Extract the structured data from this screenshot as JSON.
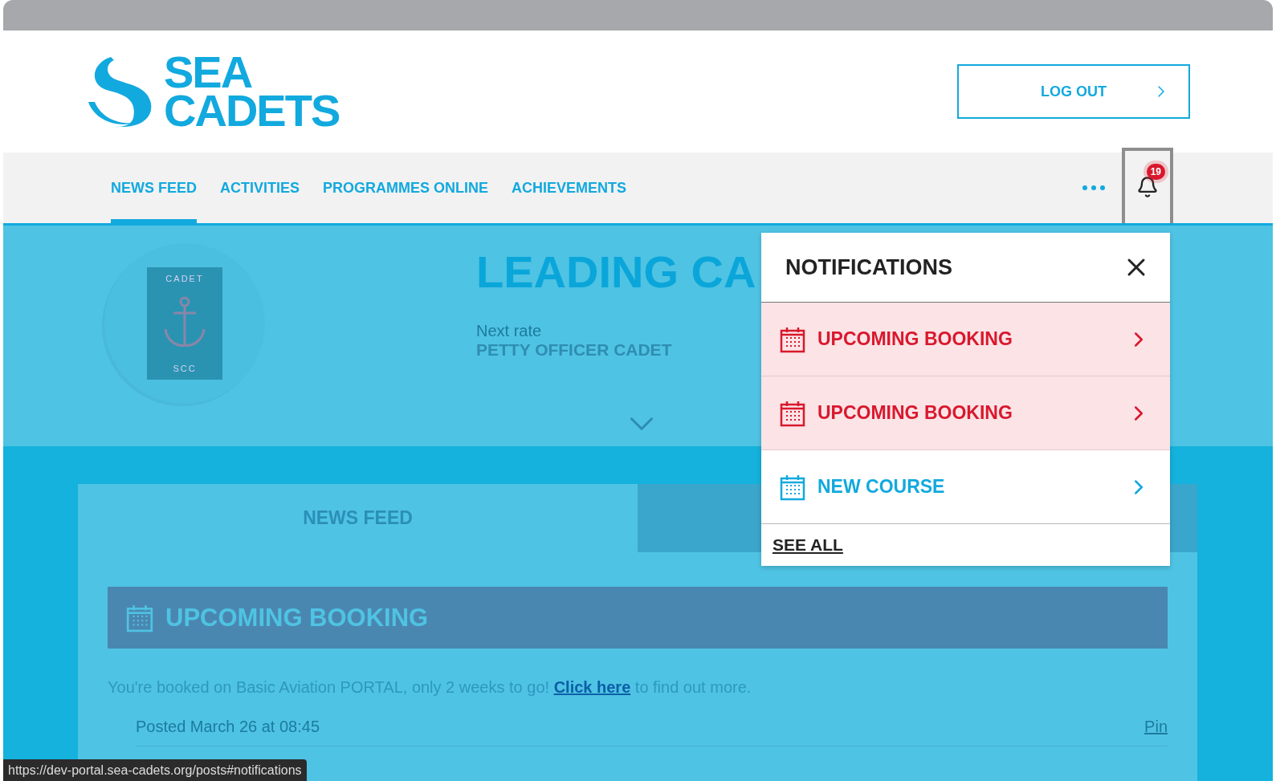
{
  "header": {
    "logo": [
      "SEA",
      "CADETS"
    ],
    "logout_button": "LOG OUT"
  },
  "nav": {
    "items": [
      {
        "label": "NEWS FEED",
        "selected": true
      },
      {
        "label": "ACTIVITIES",
        "selected": false
      },
      {
        "label": "PROGRAMMES ONLINE",
        "selected": false
      },
      {
        "label": "ACHIEVEMENTS",
        "selected": false
      }
    ],
    "notification_count": "19"
  },
  "hero": {
    "badge": {
      "top": "CADET",
      "bottom": "SCC"
    },
    "title": "LEADING CA",
    "next_rate_label": "Next rate",
    "next_rate": "PETTY OFFICER CADET"
  },
  "notifications": {
    "title": "NOTIFICATIONS",
    "items": [
      {
        "label": "UPCOMING BOOKING",
        "unread": true
      },
      {
        "label": "UPCOMING BOOKING",
        "unread": true
      },
      {
        "label": "NEW COURSE",
        "unread": false
      }
    ],
    "see_all": "SEE ALL"
  },
  "feed": {
    "tabs": [
      {
        "label": "NEWS FEED",
        "selected": true
      },
      {
        "selected": false
      }
    ],
    "post": {
      "title": "UPCOMING BOOKING",
      "text_before": "You're booked on Basic Aviation PORTAL, only 2 weeks to go! ",
      "link": "Click here",
      "text_after": " to find out more.",
      "posted": "Posted March 26 at 08:45",
      "pin": "Pin"
    }
  },
  "status_url": "https://dev-portal.sea-cadets.org/posts#notifications"
}
